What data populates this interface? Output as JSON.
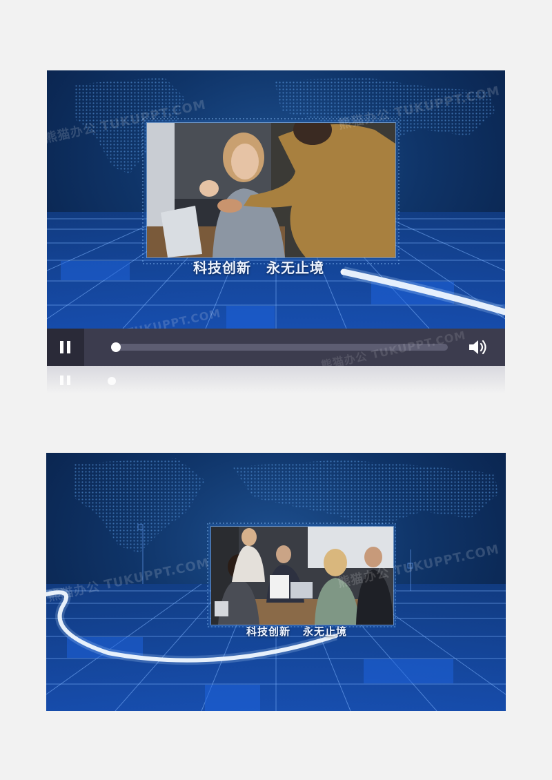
{
  "player1": {
    "caption_part1": "科技创新",
    "caption_part2": "永无止境",
    "watermark_top": "熊猫办公 TUKUPPT.COM",
    "watermark_bottom_left": "熊猫办公 TUKUPPT.COM",
    "watermark_bottom_right": "熊猫办公 TUKUPPT.COM",
    "controls": {
      "play_state_icon": "pause-icon",
      "volume_icon": "volume-icon",
      "progress": 0.0
    }
  },
  "player2": {
    "caption_part1": "科技创新",
    "caption_part2": "永无止境",
    "watermark_left": "熊猫办公 TUKUPPT.COM",
    "watermark_right": "熊猫办公 TUKUPPT.COM"
  },
  "colors": {
    "page_bg": "#f2f2f2",
    "frame_blue": "#0f3468",
    "grid_blue": "#1f5bd0",
    "control_bar": "#3c3c4e"
  }
}
